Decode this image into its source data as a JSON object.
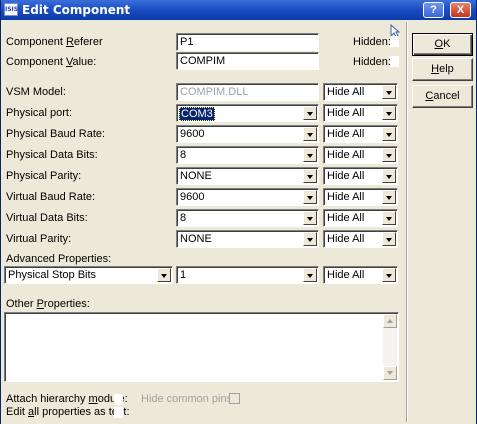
{
  "window": {
    "title": "Edit Component",
    "app_icon_text": "ISIS",
    "help_btn": "?",
    "close_btn": "X"
  },
  "fields": {
    "ref_label_pre": "Component ",
    "ref_label_u": "R",
    "ref_label_post": "eferer",
    "ref_value": "P1",
    "val_label_pre": "Component ",
    "val_label_u": "V",
    "val_label_post": "alue:",
    "val_value": "COMPIM",
    "hidden_label": "Hidden:"
  },
  "properties": [
    {
      "label": "VSM Model:",
      "value": "COMPIM.DLL",
      "hide": "Hide All"
    },
    {
      "label": "Physical port:",
      "value": "COM3",
      "hide": "Hide All"
    },
    {
      "label": "Physical Baud Rate:",
      "value": "9600",
      "hide": "Hide All"
    },
    {
      "label": "Physical Data Bits:",
      "value": "8",
      "hide": "Hide All"
    },
    {
      "label": "Physical Parity:",
      "value": "NONE",
      "hide": "Hide All"
    },
    {
      "label": "Virtual Baud Rate:",
      "value": "9600",
      "hide": "Hide All"
    },
    {
      "label": "Virtual Data Bits:",
      "value": "8",
      "hide": "Hide All"
    },
    {
      "label": "Virtual Parity:",
      "value": "NONE",
      "hide": "Hide All"
    }
  ],
  "advanced": {
    "label": "Advanced Properties:",
    "property": "Physical Stop Bits",
    "value": "1",
    "hide": "Hide All"
  },
  "other": {
    "label_pre": "Other ",
    "label_u": "P",
    "label_post": "roperties:",
    "text": ""
  },
  "footer": {
    "attach_pre": "Attach hierarchy ",
    "attach_u": "m",
    "attach_post": "odule:",
    "hide_pins": "Hide common pins:",
    "edit_pre": "Edit ",
    "edit_u": "a",
    "edit_post": "ll properties as text:"
  },
  "buttons": {
    "ok_u": "O",
    "ok_rest": "K",
    "help_u": "H",
    "help_rest": "elp",
    "cancel_u": "C",
    "cancel_rest": "ancel"
  },
  "icons": {
    "cursor": "mouse-pointer-icon",
    "dropdown": "chevron-down-icon",
    "scroll_up": "scroll-up-arrow-icon",
    "scroll_down": "scroll-down-arrow-icon"
  },
  "colors": {
    "titlebar": "#1c4fc4",
    "dialog_bg": "#ece9d8",
    "selection": "#0a246a",
    "close_button": "#c0381b"
  }
}
